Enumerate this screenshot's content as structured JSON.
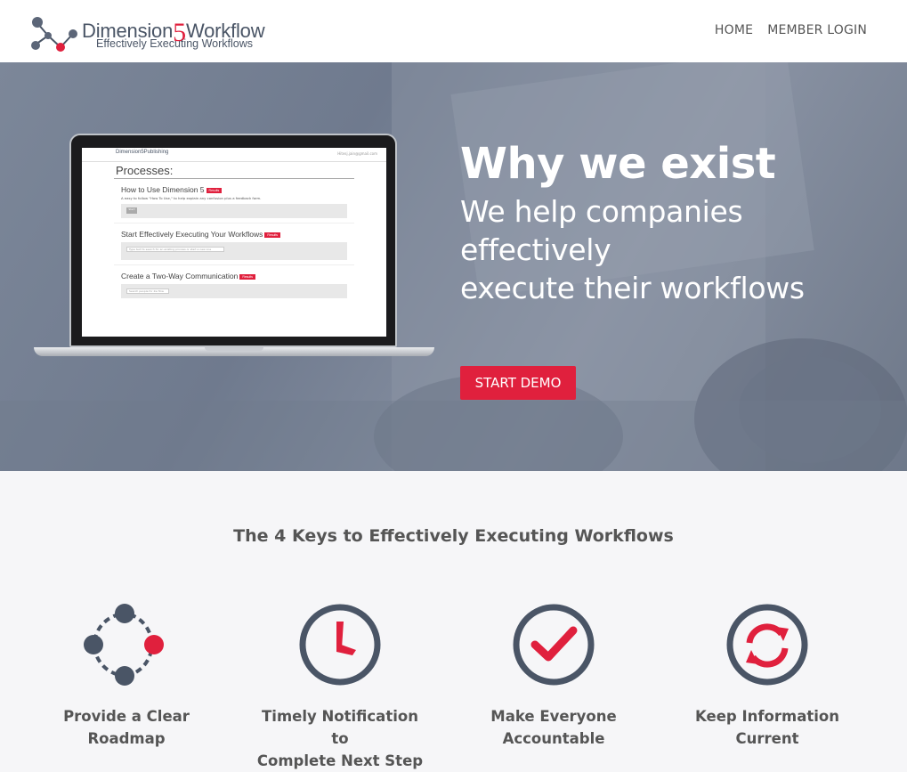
{
  "header": {
    "logo_title_part1": "Dimension",
    "logo_title_five": "5",
    "logo_title_part2": "Workflow",
    "logo_tagline": "Effectively Executing Workflows",
    "nav": [
      {
        "label": "HOME"
      },
      {
        "label": "MEMBER LOGIN"
      }
    ]
  },
  "hero": {
    "title": "Why we exist",
    "subtitle_line1": "We help companies",
    "subtitle_line2": "effectively",
    "subtitle_line3": "execute their workflows",
    "cta_label": "START DEMO",
    "laptop_screen": {
      "logo": "Dimension5Publishing",
      "user_text": "Hitesj.jain@gmail.com",
      "page_title": "Processes:",
      "sections": [
        {
          "title": "How to Use Dimension 5",
          "badge": "Results",
          "desc": "A easy to follow \"How To Use,\" to help explain any confusion plus a feedback form.",
          "button": "Start"
        },
        {
          "title": "Start Effectively Executing Your Workflows",
          "badge": "Results",
          "input": "Type text to search for an existing process or start a new one"
        },
        {
          "title": "Create a Two-Way Communication",
          "badge": "Results",
          "input": "Search people for 2w flow"
        }
      ]
    }
  },
  "keys": {
    "heading": "The 4 Keys to Effectively Executing Workflows",
    "items": [
      {
        "line1": "Provide a Clear",
        "line2": "Roadmap",
        "icon": "roadmap-icon"
      },
      {
        "line1": "Timely Notification to",
        "line2": "Complete Next Step",
        "icon": "clock-icon"
      },
      {
        "line1": "Make Everyone",
        "line2": "Accountable",
        "icon": "checkmark-icon"
      },
      {
        "line1": "Keep Information",
        "line2": "Current",
        "icon": "refresh-icon"
      }
    ]
  },
  "colors": {
    "accent": "#e0203d",
    "icon_dark": "#4a5566",
    "hero_overlay": "#7a8597"
  }
}
